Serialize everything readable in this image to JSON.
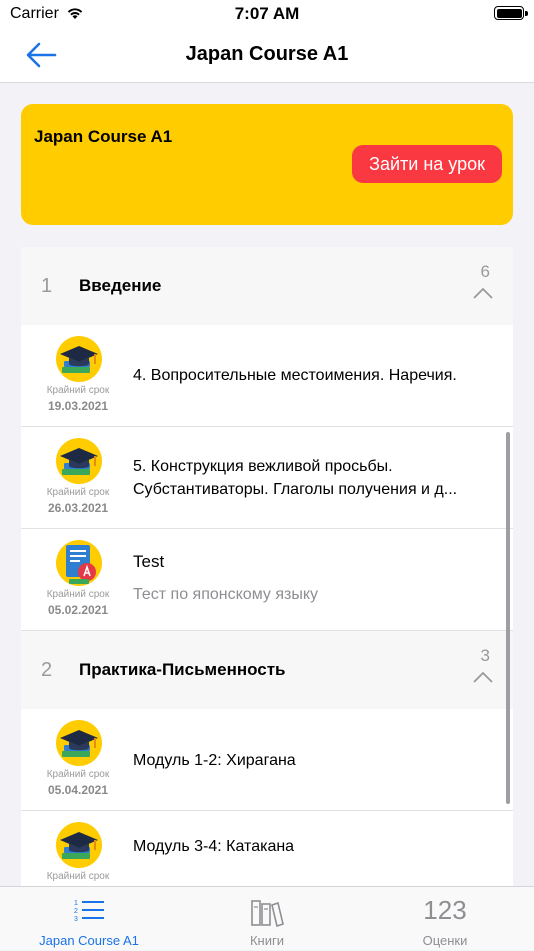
{
  "status_bar": {
    "carrier": "Carrier",
    "time": "7:07 AM"
  },
  "nav": {
    "title": "Japan Course A1",
    "back_icon": "back-arrow-icon"
  },
  "course_card": {
    "title": "Japan Course A1",
    "enter_button": "Зайти на урок"
  },
  "sections": [
    {
      "number": "1",
      "title": "Введение",
      "count": "6",
      "rows": [
        {
          "icon": "graduation-cap-icon",
          "deadline_label": "Крайний срок",
          "deadline": "19.03.2021",
          "title": "4. Вопросительные местоимения. Наречия."
        },
        {
          "icon": "graduation-cap-icon",
          "deadline_label": "Крайний срок",
          "deadline": "26.03.2021",
          "title": "5. Конструкция вежливой просьбы.",
          "title2": "Субстантиваторы. Глаголы получения и д..."
        },
        {
          "icon": "test-document-icon",
          "deadline_label": "Крайний срок",
          "deadline": "05.02.2021",
          "title": "Test",
          "subtitle": "Тест по японскому языку"
        }
      ]
    },
    {
      "number": "2",
      "title": "Практика-Письменность",
      "count": "3",
      "rows": [
        {
          "icon": "graduation-cap-icon",
          "deadline_label": "Крайний срок",
          "deadline": "05.04.2021",
          "title": "Модуль 1-2: Хирагана"
        },
        {
          "icon": "graduation-cap-icon",
          "deadline_label": "Крайний срок",
          "deadline": "",
          "title": "Модуль 3-4: Катакана"
        }
      ]
    }
  ],
  "tab_bar": {
    "tabs": [
      {
        "label": "Japan Course A1",
        "icon": "numbered-list-icon",
        "active": true
      },
      {
        "label": "Книги",
        "icon": "books-icon",
        "active": false
      },
      {
        "label": "Оценки",
        "icon_text": "123",
        "active": false
      }
    ]
  },
  "colors": {
    "accent": "#1a73e8",
    "card": "#ffcc00",
    "button": "#f93841"
  }
}
